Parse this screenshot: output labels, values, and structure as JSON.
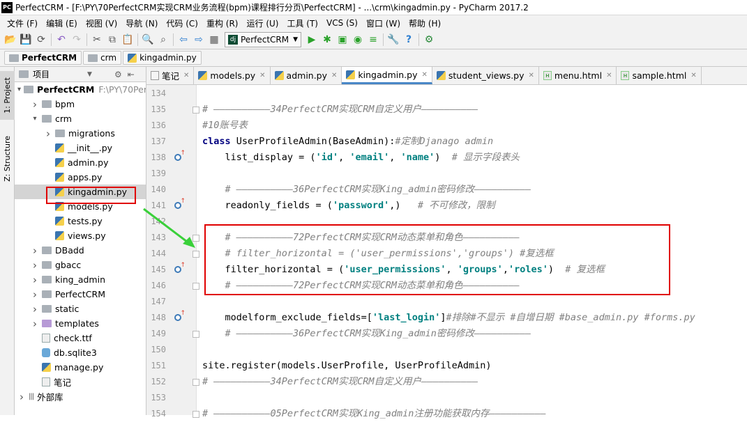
{
  "window": {
    "title": "PerfectCRM - [F:\\PY\\70PerfectCRM实现CRM业务流程(bpm)课程排行分页\\PerfectCRM] - ...\\crm\\kingadmin.py - PyCharm 2017.2",
    "app_icon": "PC"
  },
  "menu": [
    "文件 (F)",
    "编辑 (E)",
    "视图 (V)",
    "导航 (N)",
    "代码 (C)",
    "重构 (R)",
    "运行 (U)",
    "工具 (T)",
    "VCS (S)",
    "窗口 (W)",
    "帮助 (H)"
  ],
  "toolbar": {
    "run_config": "PerfectCRM",
    "run_config_icon": "dj"
  },
  "breadcrumb": [
    "PerfectCRM",
    "crm",
    "kingadmin.py"
  ],
  "side_tabs": [
    "1: Project",
    "Z: Structure"
  ],
  "project_panel": {
    "title": "项目",
    "tree": [
      {
        "label": "PerfectCRM",
        "extra": "F:\\PY\\70Perf",
        "type": "folder",
        "depth": 0,
        "expanded": true,
        "bold": true
      },
      {
        "label": "bpm",
        "type": "folder",
        "depth": 1,
        "expanded": false
      },
      {
        "label": "crm",
        "type": "folder",
        "depth": 1,
        "expanded": true
      },
      {
        "label": "migrations",
        "type": "folder",
        "depth": 2,
        "expanded": false
      },
      {
        "label": "__init__.py",
        "type": "py",
        "depth": 2
      },
      {
        "label": "admin.py",
        "type": "py",
        "depth": 2
      },
      {
        "label": "apps.py",
        "type": "py",
        "depth": 2
      },
      {
        "label": "kingadmin.py",
        "type": "py",
        "depth": 2,
        "selected": true
      },
      {
        "label": "models.py",
        "type": "py",
        "depth": 2
      },
      {
        "label": "tests.py",
        "type": "py",
        "depth": 2
      },
      {
        "label": "views.py",
        "type": "py",
        "depth": 2
      },
      {
        "label": "DBadd",
        "type": "folder",
        "depth": 1,
        "expanded": false
      },
      {
        "label": "gbacc",
        "type": "folder",
        "depth": 1,
        "expanded": false
      },
      {
        "label": "king_admin",
        "type": "folder",
        "depth": 1,
        "expanded": false
      },
      {
        "label": "PerfectCRM",
        "type": "folder",
        "depth": 1,
        "expanded": false
      },
      {
        "label": "static",
        "type": "folder",
        "depth": 1,
        "expanded": false
      },
      {
        "label": "templates",
        "type": "folder-purple",
        "depth": 1,
        "expanded": false
      },
      {
        "label": "check.ttf",
        "type": "txt",
        "depth": 1
      },
      {
        "label": "db.sqlite3",
        "type": "db",
        "depth": 1
      },
      {
        "label": "manage.py",
        "type": "py",
        "depth": 1
      },
      {
        "label": "笔记",
        "type": "txt",
        "depth": 1
      },
      {
        "label": "外部库",
        "type": "lib",
        "depth": 0,
        "expanded": false
      }
    ]
  },
  "tabs": [
    {
      "label": "笔记",
      "icon": "note-icon",
      "active": false
    },
    {
      "label": "models.py",
      "icon": "python-file-icon",
      "active": false
    },
    {
      "label": "admin.py",
      "icon": "python-file-icon",
      "active": false
    },
    {
      "label": "kingadmin.py",
      "icon": "python-file-icon",
      "active": true
    },
    {
      "label": "student_views.py",
      "icon": "python-file-icon",
      "active": false
    },
    {
      "label": "menu.html",
      "icon": "html-file-icon",
      "active": false
    },
    {
      "label": "sample.html",
      "icon": "html-file-icon",
      "active": false
    }
  ],
  "code_lines": [
    {
      "n": "134",
      "tokens": []
    },
    {
      "n": "135",
      "tokens": [
        [
          "cm",
          "# ——————————34PerfectCRM实现CRM自定义用户——————————"
        ]
      ]
    },
    {
      "n": "136",
      "tokens": [
        [
          "cm",
          "#10账号表"
        ]
      ]
    },
    {
      "n": "137",
      "tokens": [
        [
          "kw",
          "class "
        ],
        [
          "",
          "UserProfileAdmin(BaseAdmin):"
        ],
        [
          "cm",
          "#定制Djanago admin"
        ]
      ]
    },
    {
      "n": "138",
      "tokens": [
        [
          "",
          "    list_display = ("
        ],
        [
          "str",
          "'id'"
        ],
        [
          "",
          ", "
        ],
        [
          "str",
          "'email'"
        ],
        [
          "",
          ", "
        ],
        [
          "str",
          "'name'"
        ],
        [
          "",
          ")  "
        ],
        [
          "cm",
          "# 显示字段表头"
        ]
      ]
    },
    {
      "n": "139",
      "tokens": []
    },
    {
      "n": "140",
      "tokens": [
        [
          "cm",
          "    # ——————————36PerfectCRM实现King_admin密码修改——————————"
        ]
      ]
    },
    {
      "n": "141",
      "tokens": [
        [
          "",
          "    readonly_fields = ("
        ],
        [
          "str",
          "'password'"
        ],
        [
          "",
          ",)   "
        ],
        [
          "cm",
          "# 不可修改，限制"
        ]
      ]
    },
    {
      "n": "142",
      "tokens": []
    },
    {
      "n": "143",
      "tokens": [
        [
          "cm",
          "    # ——————————72PerfectCRM实现CRM动态菜单和角色——————————"
        ]
      ]
    },
    {
      "n": "144",
      "tokens": [
        [
          "cm",
          "    # filter_horizontal = ('user_permissions','groups') #复选框"
        ]
      ]
    },
    {
      "n": "145",
      "tokens": [
        [
          "",
          "    filter_horizontal = ("
        ],
        [
          "str",
          "'user_permissions'"
        ],
        [
          "",
          ", "
        ],
        [
          "str",
          "'groups'"
        ],
        [
          "",
          ","
        ],
        [
          "str",
          "'roles'"
        ],
        [
          "",
          ")  "
        ],
        [
          "cm",
          "# 复选框"
        ]
      ]
    },
    {
      "n": "146",
      "tokens": [
        [
          "cm",
          "    # ——————————72PerfectCRM实现CRM动态菜单和角色——————————"
        ]
      ]
    },
    {
      "n": "147",
      "tokens": []
    },
    {
      "n": "148",
      "tokens": [
        [
          "",
          "    modelform_exclude_fields=["
        ],
        [
          "str",
          "'last_login'"
        ],
        [
          "",
          "]"
        ],
        [
          "cm",
          "#排除#不显示 #自增日期 #base_admin.py #forms.py"
        ]
      ]
    },
    {
      "n": "149",
      "tokens": [
        [
          "cm",
          "    # ——————————36PerfectCRM实现King_admin密码修改——————————"
        ]
      ]
    },
    {
      "n": "150",
      "tokens": []
    },
    {
      "n": "151",
      "tokens": [
        [
          "",
          "site.register(models.UserProfile, UserProfileAdmin)"
        ]
      ]
    },
    {
      "n": "152",
      "tokens": [
        [
          "cm",
          "# ——————————34PerfectCRM实现CRM自定义用户——————————"
        ]
      ]
    },
    {
      "n": "153",
      "tokens": []
    },
    {
      "n": "154",
      "tokens": [
        [
          "cm",
          "# ——————————05PerfectCRM实现King_admin注册功能获取内存——————————"
        ]
      ]
    }
  ],
  "gutter_overrides": [
    "138",
    "141",
    "145",
    "148"
  ],
  "fold_markers": [
    "135",
    "143",
    "144",
    "146",
    "149",
    "152",
    "154"
  ],
  "colors": {
    "highlight_box": "#e00000",
    "annotation_arrow": "#3ad03a"
  }
}
